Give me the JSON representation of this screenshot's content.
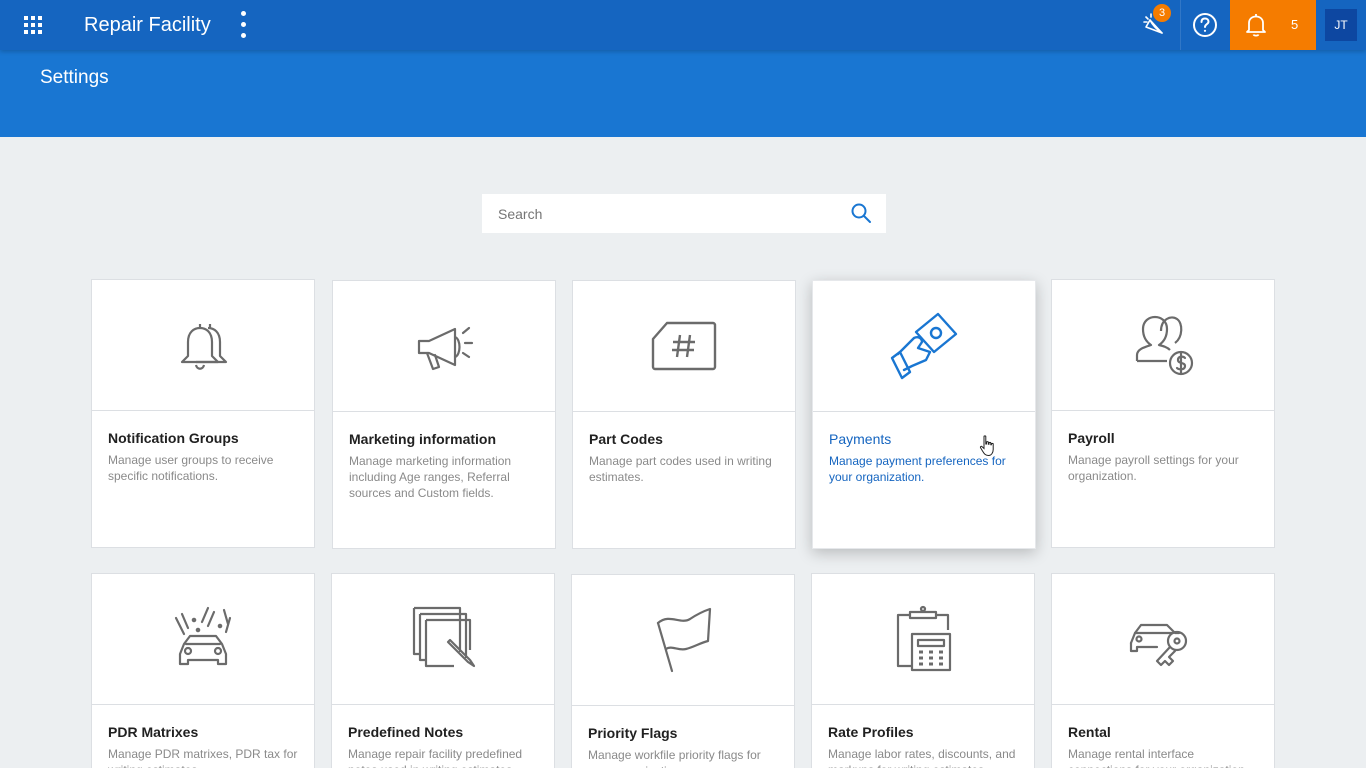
{
  "topbar": {
    "app_title": "Repair Facility",
    "apps_icon": "apps-grid-icon",
    "menu_icon": "more-vertical-icon",
    "celebrate_badge": "3",
    "help_icon": "help-circle-icon",
    "notifications_count": "5",
    "avatar_initials": "JT",
    "colors": {
      "bar": "#1565c0",
      "notifications": "#f57c00",
      "avatar": "#0d47a1"
    }
  },
  "page": {
    "title": "Settings",
    "header_color": "#1976d2"
  },
  "search": {
    "placeholder": "Search"
  },
  "cards": [
    {
      "title": "Notification Groups",
      "desc": "Manage user groups to receive specific notifications.",
      "icon": "bell-icon"
    },
    {
      "title": "Marketing information",
      "desc": "Manage marketing information including Age ranges, Referral sources and Custom fields.",
      "icon": "megaphone-icon"
    },
    {
      "title": "Part Codes",
      "desc": "Manage part codes used in writing estimates.",
      "icon": "hash-tag-icon"
    },
    {
      "title": "Payments",
      "desc": "Manage payment preferences for your organization.",
      "icon": "hand-money-icon",
      "active": true
    },
    {
      "title": "Payroll",
      "desc": "Manage payroll settings for your organization.",
      "icon": "users-dollar-icon"
    },
    {
      "title": "PDR Matrixes",
      "desc": "Manage PDR matrixes, PDR tax for writing estimates.",
      "icon": "car-hail-icon"
    },
    {
      "title": "Predefined Notes",
      "desc": "Manage repair facility predefined notes used in writing estimates.",
      "icon": "notes-pencil-icon"
    },
    {
      "title": "Priority Flags",
      "desc": "Manage workfile priority flags for your organization.",
      "icon": "flag-icon"
    },
    {
      "title": "Rate Profiles",
      "desc": "Manage labor rates, discounts, and markups for writing estimates.",
      "icon": "clipboard-calculator-icon"
    },
    {
      "title": "Rental",
      "desc": "Manage rental interface connections for your organization.",
      "icon": "car-key-icon"
    }
  ],
  "accent_color": "#1565c0"
}
